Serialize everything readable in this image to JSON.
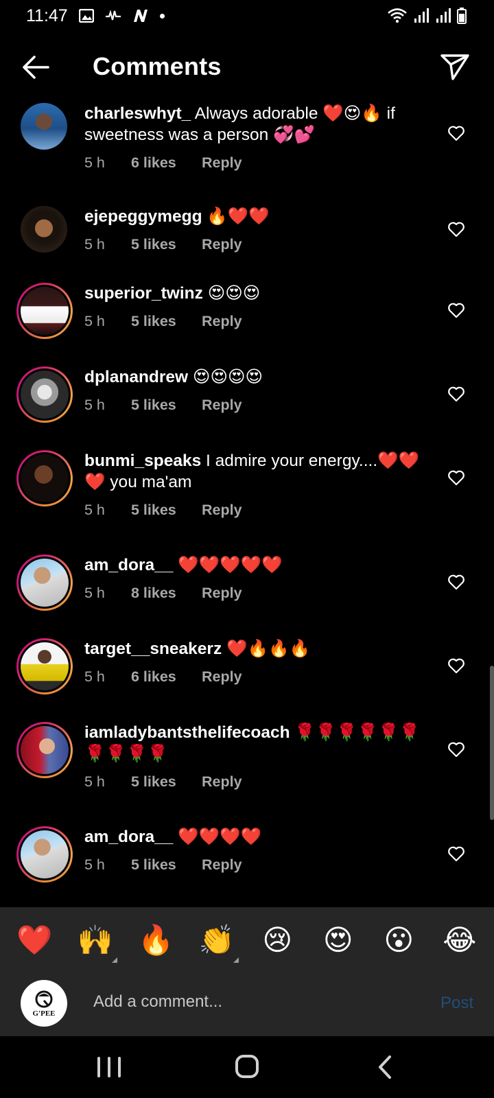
{
  "status_bar": {
    "time": "11:47",
    "left_icons": [
      "gallery-icon",
      "voicemail-icon",
      "n-app-icon",
      "dot-icon"
    ],
    "right_icons": [
      "wifi-icon",
      "signal-icon",
      "signal-icon",
      "battery-icon"
    ]
  },
  "header": {
    "title": "Comments",
    "back_icon": "arrow-left-icon",
    "share_icon": "send-icon"
  },
  "comments": [
    {
      "username": "charleswhyt_",
      "text": "Always adorable ❤️😍🔥 if sweetness was a person 💞💕",
      "time": "5 h",
      "likes": "6 likes",
      "reply": "Reply"
    },
    {
      "username": "ejepeggymegg",
      "text": "🔥❤️❤️",
      "time": "5 h",
      "likes": "5 likes",
      "reply": "Reply"
    },
    {
      "username": "superior_twinz",
      "text": "😍😍😍",
      "time": "5 h",
      "likes": "5 likes",
      "reply": "Reply"
    },
    {
      "username": "dplanandrew",
      "text": "😍😍😍😍",
      "time": "5 h",
      "likes": "5 likes",
      "reply": "Reply"
    },
    {
      "username": "bunmi_speaks",
      "text": "I admire your energy....❤️❤️❤️ you ma'am",
      "time": "5 h",
      "likes": "5 likes",
      "reply": "Reply"
    },
    {
      "username": "am_dora__",
      "text": "❤️❤️❤️❤️❤️",
      "time": "5 h",
      "likes": "8 likes",
      "reply": "Reply"
    },
    {
      "username": "target__sneakerz",
      "text": "❤️🔥🔥🔥",
      "time": "5 h",
      "likes": "6 likes",
      "reply": "Reply"
    },
    {
      "username": "iamladybantsthelifecoach",
      "text": "🌹🌹🌹🌹🌹🌹🌹🌹🌹🌹",
      "time": "5 h",
      "likes": "5 likes",
      "reply": "Reply"
    },
    {
      "username": "am_dora__",
      "text": "❤️❤️❤️❤️",
      "time": "5 h",
      "likes": "5 likes",
      "reply": "Reply"
    }
  ],
  "reactions": [
    "❤️",
    "🙌",
    "🔥",
    "👏",
    "😢",
    "😍",
    "😮",
    "😂"
  ],
  "composer": {
    "avatar_text": "G'PEE",
    "placeholder": "Add a comment...",
    "post_label": "Post"
  },
  "colors": {
    "background": "#000000",
    "secondary_text": "#a8a8a8",
    "bar_background": "#262626",
    "post_disabled": "#1f4f7a",
    "story_ring": "#d4206f"
  }
}
